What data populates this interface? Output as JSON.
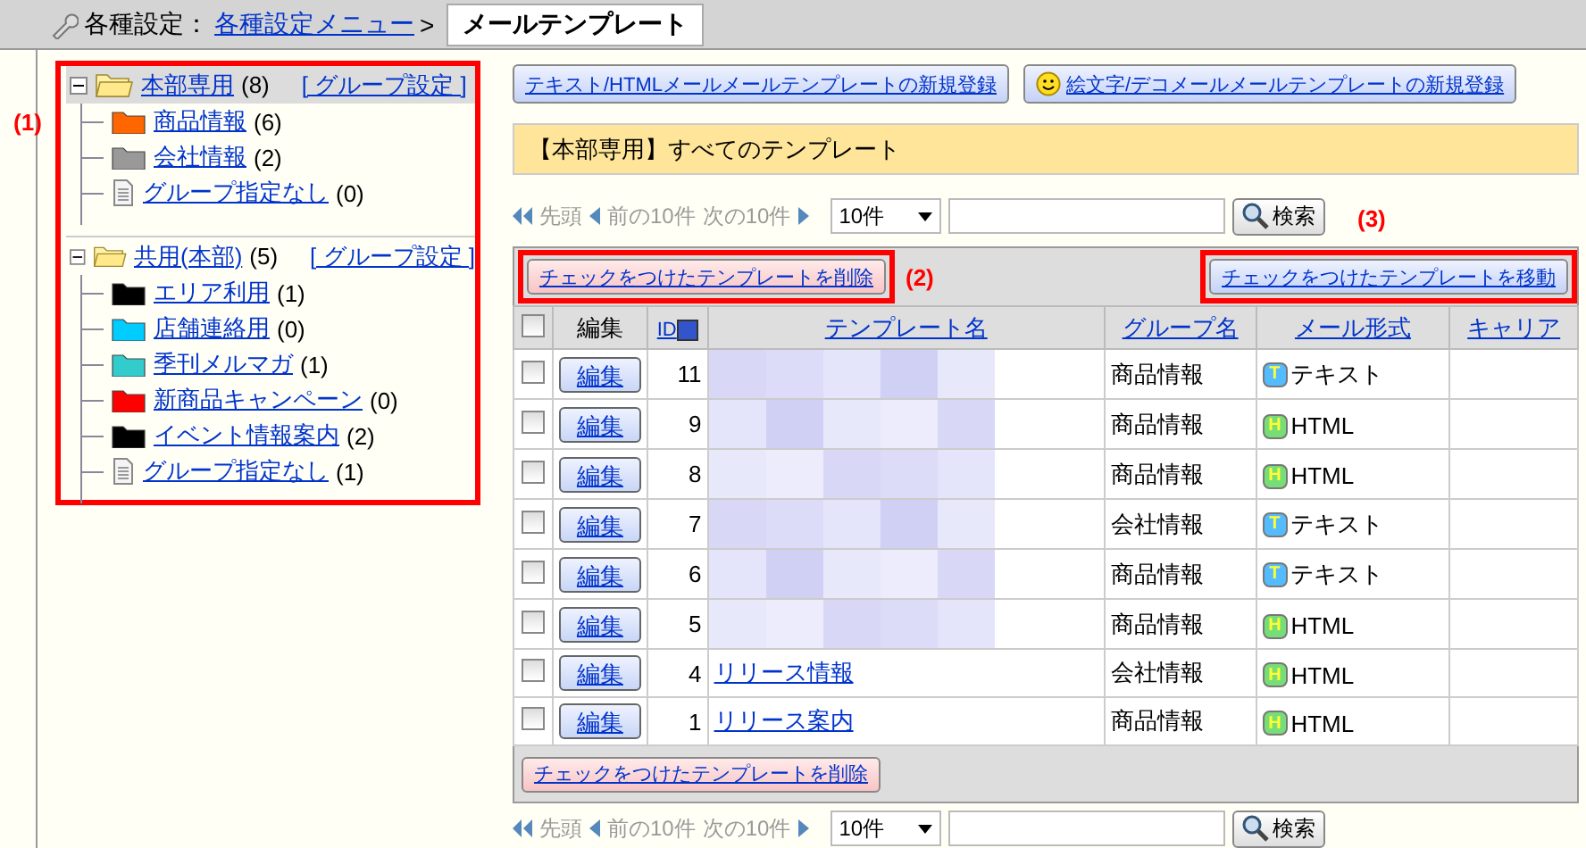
{
  "breadcrumb": {
    "root": "各種設定：",
    "link": "各種設定メニュー",
    "separator": ">",
    "current": "メールテンプレート"
  },
  "annotations": [
    {
      "label": "(1)"
    },
    {
      "label": "(2)"
    },
    {
      "label": "(3)"
    }
  ],
  "sidebar": {
    "groups": [
      {
        "name": "本部専用",
        "count": "(8)",
        "settings": "[ グループ設定 ]",
        "expanded": true,
        "selected": true,
        "children": [
          {
            "kind": "folder",
            "name": "商品情報",
            "count": "(6)",
            "color": "#ff6600"
          },
          {
            "kind": "folder",
            "name": "会社情報",
            "count": "(2)",
            "color": "#999999"
          },
          {
            "kind": "document",
            "name": "グループ指定なし",
            "count": "(0)"
          }
        ]
      },
      {
        "name": "共用(本部)",
        "count": "(5)",
        "settings": "[ グループ設定 ]",
        "expanded": true,
        "selected": false,
        "children": [
          {
            "kind": "folder",
            "name": "エリア利用",
            "count": "(1)",
            "color": "#000000"
          },
          {
            "kind": "folder",
            "name": "店舗連絡用",
            "count": "(0)",
            "color": "#00ccff"
          },
          {
            "kind": "folder",
            "name": "季刊メルマガ",
            "count": "(1)",
            "color": "#33cccc"
          },
          {
            "kind": "folder",
            "name": "新商品キャンペーン",
            "count": "(0)",
            "color": "#ff0000"
          },
          {
            "kind": "folder",
            "name": "イベント情報案内",
            "count": "(2)",
            "color": "#000000"
          },
          {
            "kind": "document",
            "name": "グループ指定なし",
            "count": "(1)"
          }
        ]
      }
    ]
  },
  "new_buttons": [
    {
      "kind": "plain",
      "label": "テキスト/HTMLメールメールテンプレートの新規登録"
    },
    {
      "kind": "emoji",
      "label": "絵文字/デコメールメールテンプレートの新規登録"
    }
  ],
  "heading": "【本部専用】すべてのテンプレート",
  "pagers": [
    {
      "first": "先頭",
      "prev": "前の10件",
      "next": "次の10件",
      "per_page": "10件",
      "search_button": "検索"
    },
    {
      "first": "先頭",
      "prev": "前の10件",
      "next": "次の10件",
      "per_page": "10件",
      "search_button": "検索"
    }
  ],
  "delete_button": "チェックをつけたテンプレートを削除",
  "move_button": "チェックをつけたテンプレートを移動",
  "table": {
    "columns": [
      "編集",
      "ID",
      "テンプレート名",
      "グループ名",
      "メール形式",
      "キャリア"
    ],
    "select_all_checked": false,
    "rows": [
      {
        "checked": false,
        "edit": "編集",
        "id": "11",
        "name": {
          "kind": "redacted"
        },
        "group": "商品情報",
        "format": {
          "kind": "text",
          "badge": "T",
          "label": "テキスト"
        }
      },
      {
        "checked": false,
        "edit": "編集",
        "id": "9",
        "name": {
          "kind": "redacted"
        },
        "group": "商品情報",
        "format": {
          "kind": "html",
          "badge": "H",
          "label": "HTML"
        }
      },
      {
        "checked": false,
        "edit": "編集",
        "id": "8",
        "name": {
          "kind": "redacted"
        },
        "group": "商品情報",
        "format": {
          "kind": "html",
          "badge": "H",
          "label": "HTML"
        }
      },
      {
        "checked": false,
        "edit": "編集",
        "id": "7",
        "name": {
          "kind": "redacted"
        },
        "group": "会社情報",
        "format": {
          "kind": "text",
          "badge": "T",
          "label": "テキスト"
        }
      },
      {
        "checked": false,
        "edit": "編集",
        "id": "6",
        "name": {
          "kind": "redacted"
        },
        "group": "商品情報",
        "format": {
          "kind": "text",
          "badge": "T",
          "label": "テキスト"
        }
      },
      {
        "checked": false,
        "edit": "編集",
        "id": "5",
        "name": {
          "kind": "redacted"
        },
        "group": "商品情報",
        "format": {
          "kind": "html",
          "badge": "H",
          "label": "HTML"
        }
      },
      {
        "checked": false,
        "edit": "編集",
        "id": "4",
        "name": {
          "kind": "link",
          "text": "リリース情報"
        },
        "group": "会社情報",
        "format": {
          "kind": "html",
          "badge": "H",
          "label": "HTML"
        }
      },
      {
        "checked": false,
        "edit": "編集",
        "id": "1",
        "name": {
          "kind": "link",
          "text": "リリース案内"
        },
        "group": "商品情報",
        "format": {
          "kind": "html",
          "badge": "H",
          "label": "HTML"
        }
      }
    ]
  },
  "bottom_delete_button": "チェックをつけたテンプレートを削除"
}
